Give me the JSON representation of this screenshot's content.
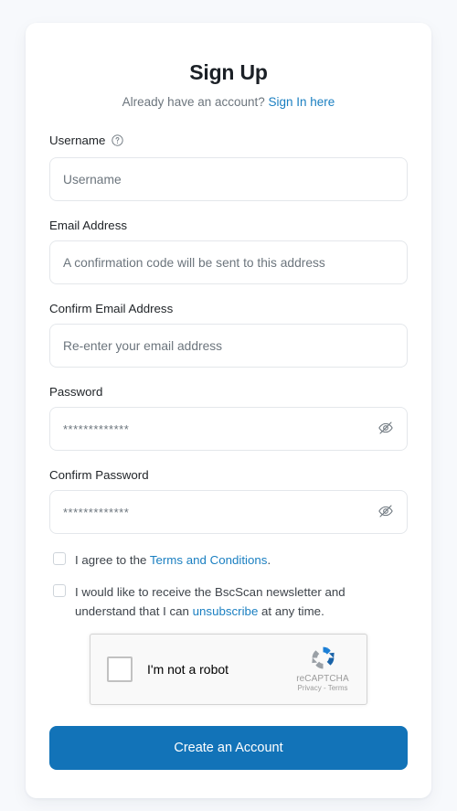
{
  "header": {
    "title": "Sign Up",
    "subtitle_prefix": "Already have an account? ",
    "signin_link": "Sign In here"
  },
  "fields": {
    "username": {
      "label": "Username",
      "placeholder": "Username",
      "value": "",
      "help_icon": "question-circle-icon"
    },
    "email": {
      "label": "Email Address",
      "placeholder": "A confirmation code will be sent to this address",
      "value": ""
    },
    "confirm_email": {
      "label": "Confirm Email Address",
      "placeholder": "Re-enter your email address",
      "value": ""
    },
    "password": {
      "label": "Password",
      "placeholder": "*************",
      "value": "",
      "toggle_icon": "eye-off-icon"
    },
    "confirm_password": {
      "label": "Confirm Password",
      "placeholder": "*************",
      "value": "",
      "toggle_icon": "eye-off-icon"
    }
  },
  "checkboxes": {
    "terms": {
      "checked": false,
      "text_before": "I agree to the ",
      "link": "Terms and Conditions",
      "text_after": "."
    },
    "newsletter": {
      "checked": false,
      "text_before": "I would like to receive the BscScan newsletter and understand that I can ",
      "link": "unsubscribe",
      "text_after": " at any time."
    }
  },
  "recaptcha": {
    "checked": false,
    "label": "I'm not a robot",
    "brand": "reCAPTCHA",
    "legal": "Privacy - Terms",
    "logo_icon": "recaptcha-logo-icon"
  },
  "submit": {
    "label": "Create an Account"
  },
  "colors": {
    "accent": "#1273b8",
    "link": "#1a7fc1",
    "page_bg": "#f7f9fc",
    "card_bg": "#ffffff",
    "border": "#e4e7eb",
    "muted_text": "#6c757d"
  }
}
